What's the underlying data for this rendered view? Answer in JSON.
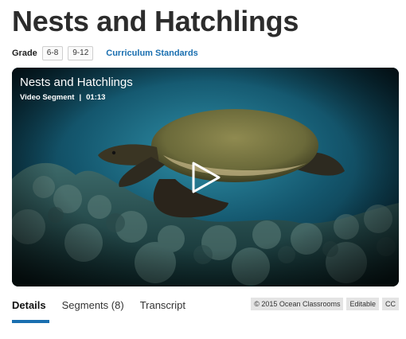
{
  "page": {
    "title": "Nests and Hatchlings"
  },
  "grade": {
    "label": "Grade",
    "levels": [
      "6-8",
      "9-12"
    ],
    "standards_link": "Curriculum Standards"
  },
  "video": {
    "title": "Nests and Hatchlings",
    "type": "Video Segment",
    "separator": "|",
    "duration": "01:13",
    "play_icon": "play-icon",
    "subject": "sea turtle swimming over coral reef"
  },
  "tabs": [
    {
      "label": "Details",
      "active": true
    },
    {
      "label": "Segments (8)",
      "active": false
    },
    {
      "label": "Transcript",
      "active": false
    }
  ],
  "badges": [
    "© 2015 Ocean Classrooms",
    "Editable",
    "CC"
  ],
  "colors": {
    "accent": "#1a6fb0",
    "title": "#2c2c2c",
    "badge_bg": "#e4e4e4"
  }
}
